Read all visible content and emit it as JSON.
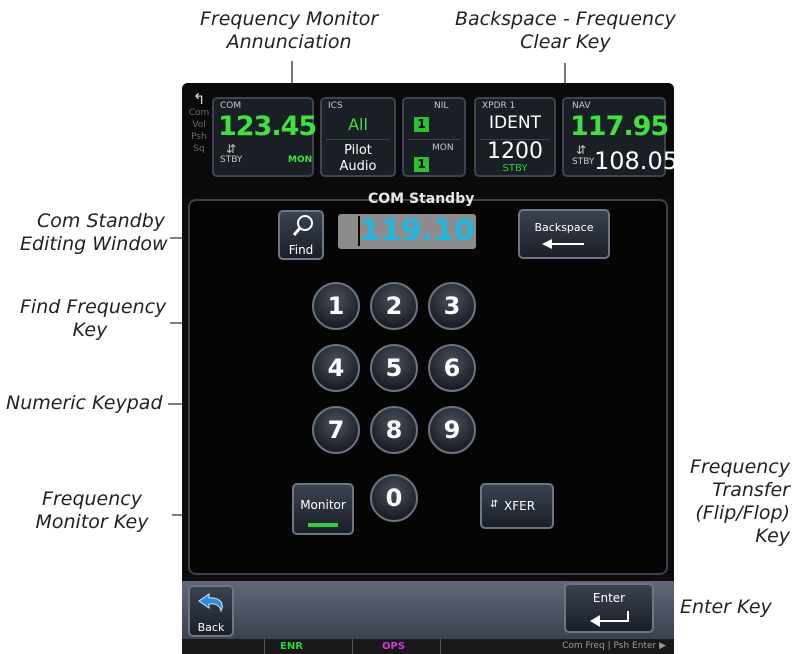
{
  "callouts": {
    "frequency_monitor_annunciation": [
      "Frequency Monitor",
      "Annunciation"
    ],
    "backspace_frequency_clear_key": [
      "Backspace - Frequency",
      "Clear Key"
    ],
    "com_standby_editing_window": [
      "Com Standby",
      "Editing Window"
    ],
    "find_frequency_key": [
      "Find Frequency",
      "Key"
    ],
    "numeric_keypad": [
      "Numeric Keypad"
    ],
    "frequency_monitor_key": [
      "Frequency",
      "Monitor Key"
    ],
    "frequency_transfer_key": [
      "Frequency",
      "Transfer",
      "(Flip/Flop)",
      "Key"
    ],
    "enter_key": [
      "Enter Key"
    ]
  },
  "side_button": {
    "line1": "Com",
    "line2": "Vol",
    "line3": "Psh",
    "line4": "Sq"
  },
  "com_tile": {
    "label": "COM",
    "freq": "123.45",
    "stby": "STBY",
    "mon": "MON"
  },
  "ics_tile": {
    "label": "ICS",
    "value": "All",
    "pilot": "Pilot",
    "audio": "Audio"
  },
  "nil_tile": {
    "label": "NIL",
    "value": "1",
    "mon_label": "MON",
    "mon_value": "1"
  },
  "xpdr_tile": {
    "label": "XPDR 1",
    "mode": "IDENT",
    "code": "1200",
    "status": "STBY"
  },
  "nav_tile": {
    "label": "NAV",
    "freq": "117.95",
    "stby": "STBY",
    "stby_freq": "108.05"
  },
  "editor": {
    "title": "COM Standby",
    "value": "119.10",
    "find_label": "Find",
    "backspace_label": "Backspace",
    "monitor_label": "Monitor",
    "xfer_label": "XFER"
  },
  "keypad": [
    "1",
    "2",
    "3",
    "4",
    "5",
    "6",
    "7",
    "8",
    "9",
    "0"
  ],
  "bottom": {
    "back_label": "Back",
    "enter_label": "Enter"
  },
  "status_bar": {
    "enr": "ENR",
    "ops": "OPS",
    "hint": "Com Freq | Psh Enter ▶"
  },
  "colors": {
    "accent_green": "#3fe040",
    "accent_cyan": "#32d2ee",
    "ops_magenta": "#d23bd2"
  }
}
